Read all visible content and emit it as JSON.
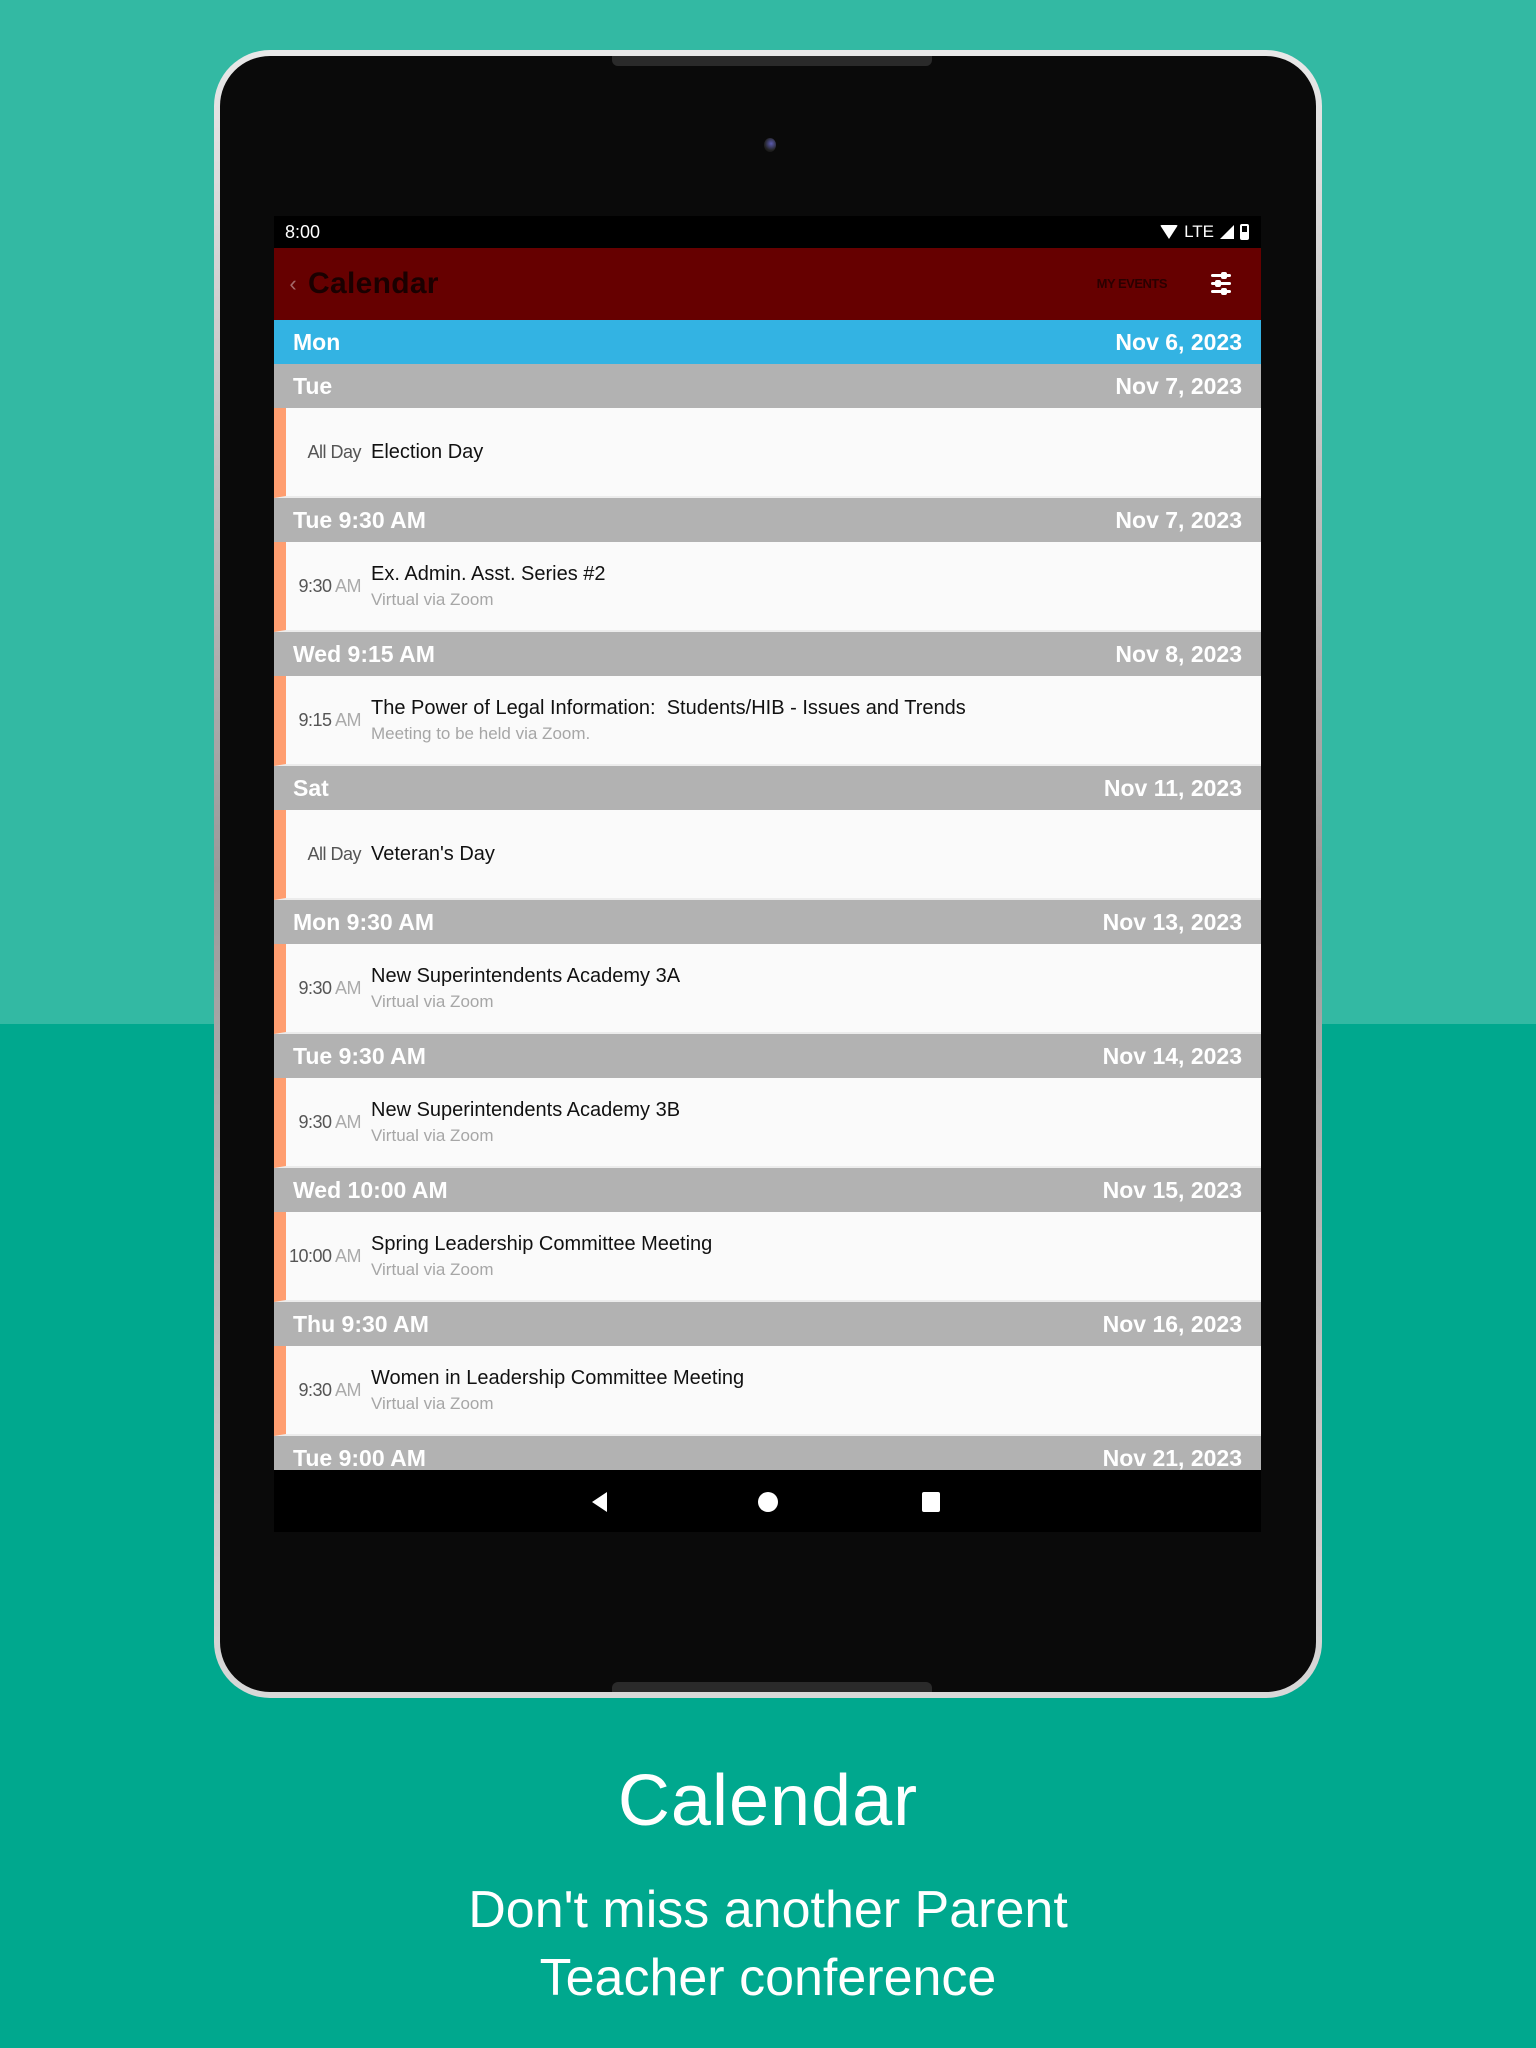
{
  "status_bar": {
    "time": "8:00",
    "network": "LTE",
    "icons": [
      "wifi-icon",
      "signal-icon",
      "battery-icon"
    ]
  },
  "app_bar": {
    "back_icon": "‹",
    "title": "Calendar",
    "my_events_label": "MY EVENTS",
    "filter_icon": "sliders-icon"
  },
  "day_headers": [
    {
      "left": "Mon",
      "right": "Nov 6, 2023",
      "today": true
    },
    {
      "left": "Tue",
      "right": "Nov 7, 2023"
    },
    {
      "left": "Tue 9:30 AM",
      "right": "Nov 7, 2023"
    },
    {
      "left": "Wed 9:15 AM",
      "right": "Nov 8, 2023"
    },
    {
      "left": "Sat",
      "right": "Nov 11, 2023"
    },
    {
      "left": "Mon 9:30 AM",
      "right": "Nov 13, 2023"
    },
    {
      "left": "Tue 9:30 AM",
      "right": "Nov 14, 2023"
    },
    {
      "left": "Wed 10:00 AM",
      "right": "Nov 15, 2023"
    },
    {
      "left": "Thu 9:30 AM",
      "right": "Nov 16, 2023"
    },
    {
      "left": "Tue 9:00 AM",
      "right": "Nov 21, 2023"
    }
  ],
  "events": [
    {
      "time": "All Day",
      "ampm": "",
      "title": "Election Day",
      "subtitle": ""
    },
    {
      "time": "9:30",
      "ampm": "AM",
      "title": "Ex. Admin. Asst. Series #2",
      "subtitle": "Virtual via Zoom"
    },
    {
      "time": "9:15",
      "ampm": "AM",
      "title": "The Power of Legal Information:  Students/HIB - Issues and Trends",
      "subtitle": "Meeting to be held via Zoom."
    },
    {
      "time": "All Day",
      "ampm": "",
      "title": "Veteran's Day",
      "subtitle": ""
    },
    {
      "time": "9:30",
      "ampm": "AM",
      "title": "New Superintendents Academy 3A",
      "subtitle": "Virtual via Zoom"
    },
    {
      "time": "9:30",
      "ampm": "AM",
      "title": "New Superintendents Academy 3B",
      "subtitle": "Virtual via Zoom"
    },
    {
      "time": "10:00",
      "ampm": "AM",
      "title": "Spring Leadership Committee Meeting",
      "subtitle": "Virtual via Zoom"
    },
    {
      "time": "9:30",
      "ampm": "AM",
      "title": "Women in Leadership Committee Meeting",
      "subtitle": "Virtual via Zoom"
    }
  ],
  "nav_bar": {
    "back": "nav-back-icon",
    "home": "nav-home-icon",
    "recents": "nav-recents-icon"
  },
  "caption": {
    "title": "Calendar",
    "subtitle_line1": "Don't miss another Parent",
    "subtitle_line2": "Teacher conference"
  },
  "colors": {
    "app_bar": "#660000",
    "today_header": "#33b3e3",
    "day_header": "#b2b2b2",
    "event_accent": "#ff9e70",
    "background_top": "#33b9a3",
    "background_bottom": "#00a88e"
  }
}
